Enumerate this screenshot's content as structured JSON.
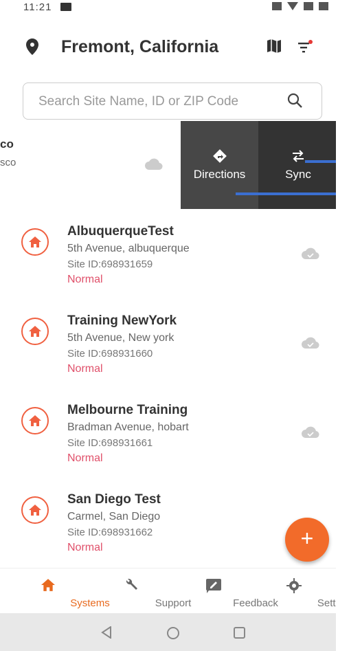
{
  "status_bar": {
    "time": "11:21"
  },
  "header": {
    "location": "Fremont, California"
  },
  "search": {
    "placeholder": "Search Site Name, ID or ZIP Code"
  },
  "swiped_item": {
    "name_fragment": "co",
    "addr_fragment": "sco"
  },
  "swipe_actions": {
    "directions_label": "Directions",
    "sync_label": "Sync"
  },
  "sites": [
    {
      "name": "AlbuquerqueTest",
      "address": "5th Avenue, albuquerque",
      "site_id": "Site ID:698931659",
      "status": "Normal"
    },
    {
      "name": "Training NewYork",
      "address": "5th Avenue, New york",
      "site_id": "Site ID:698931660",
      "status": "Normal"
    },
    {
      "name": "Melbourne Training",
      "address": "Bradman Avenue, hobart",
      "site_id": "Site ID:698931661",
      "status": "Normal"
    },
    {
      "name": "San Diego Test",
      "address": "Carmel, San Diego",
      "site_id": "Site ID:698931662",
      "status": "Normal"
    }
  ],
  "fab": {
    "label": "+"
  },
  "bottom_nav": {
    "tabs": [
      {
        "label": "Systems",
        "icon": "home-icon",
        "active": true
      },
      {
        "label": "Support",
        "icon": "wrench-icon",
        "active": false
      },
      {
        "label": "Feedback",
        "icon": "feedback-icon",
        "active": false
      },
      {
        "label": "Settings",
        "icon": "gear-icon",
        "active": false
      }
    ]
  },
  "colors": {
    "accent": "#e86a1f",
    "status_normal": "#e0506a",
    "action_dark": "#333333"
  }
}
